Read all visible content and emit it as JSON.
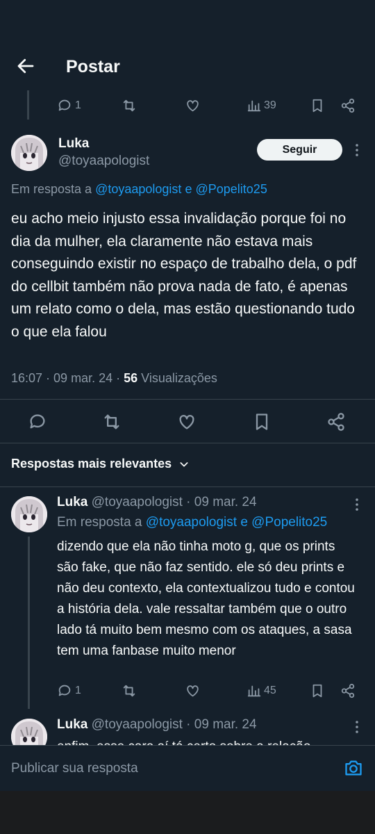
{
  "header": {
    "title": "Postar"
  },
  "top_stats": {
    "replies": "1",
    "views": "39"
  },
  "main_post": {
    "name": "Luka",
    "handle": "@toyaapologist",
    "follow_label": "Seguir",
    "reply_prefix": "Em resposta a",
    "reply_user1": "@toyaapologist",
    "reply_and": "e",
    "reply_user2": "@Popelito25",
    "text": "eu acho meio injusto essa invalidação porque foi no dia da mulher, ela claramente não estava mais conseguindo existir no espaço de trabalho dela, o pdf do cellbit também não prova nada de fato, é apenas um relato como o dela, mas estão questionando tudo o que ela falou",
    "meta_time": "16:07 · 09 mar. 24 ·",
    "meta_views_count": "56",
    "meta_views_label": "Visualizações"
  },
  "sort": {
    "label": "Respostas mais relevantes"
  },
  "reply1": {
    "name": "Luka",
    "handle_date": "@toyaapologist · 09 mar. 24",
    "reply_prefix": "Em resposta a",
    "reply_users": "@toyaapologist e @Popelito25",
    "text": "dizendo que ela não tinha moto g, que os prints são fake, que não faz sentido. ele só deu prints e não deu contexto, ela contextualizou tudo e contou a história dela. vale ressaltar também que o outro lado tá muito bem mesmo com os ataques, a sasa tem uma fanbase muito menor",
    "replies": "1",
    "views": "45"
  },
  "reply2": {
    "name": "Luka",
    "handle_date": "@toyaapologist · 09 mar. 24",
    "text_partial": "enfim, esse cara aí tá certo sobre a relação"
  },
  "composer": {
    "placeholder": "Publicar sua resposta"
  }
}
